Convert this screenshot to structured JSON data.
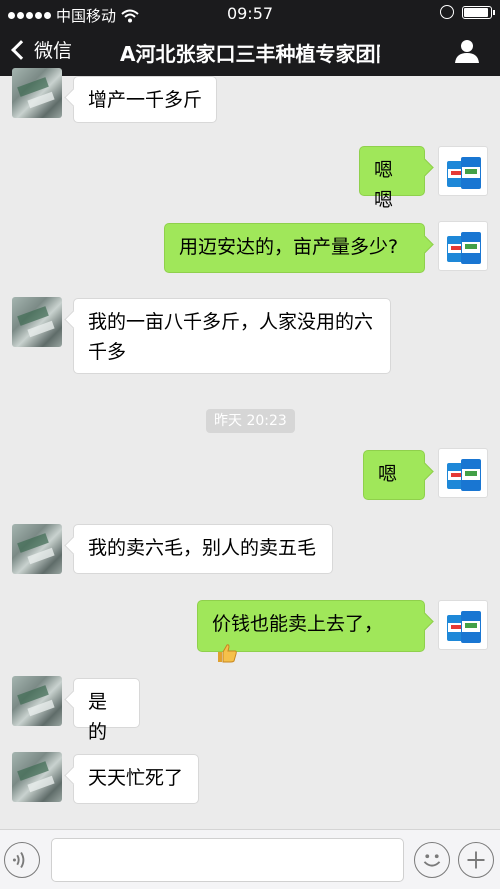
{
  "status_bar": {
    "carrier": "中国移动",
    "time": "09:57"
  },
  "nav": {
    "back_label": "微信",
    "title": "A河北张家口三丰种植专家团队"
  },
  "messages": [
    {
      "side": "left",
      "text": "增产一千多斤"
    },
    {
      "side": "right",
      "text": "嗯嗯"
    },
    {
      "side": "right",
      "text": "用迈安达的，亩产量多少?"
    },
    {
      "side": "left",
      "text": "我的一亩八千多斤，人家没用的六千多"
    },
    {
      "side": "right",
      "text": "嗯"
    },
    {
      "side": "left",
      "text": "我的卖六毛，别人的卖五毛"
    },
    {
      "side": "right",
      "text": "价钱也能卖上去了，",
      "emoji": "thumbs-up-icon"
    },
    {
      "side": "left",
      "text": "是的"
    },
    {
      "side": "left",
      "text": "天天忙死了"
    }
  ],
  "timestamp": "昨天 20:23",
  "colors": {
    "nav_bg": "#1b1b1d",
    "chat_bg": "#ebebeb",
    "bubble_self": "#a0e75a",
    "bubble_other": "#ffffff"
  },
  "input": {
    "value": "",
    "placeholder": ""
  }
}
